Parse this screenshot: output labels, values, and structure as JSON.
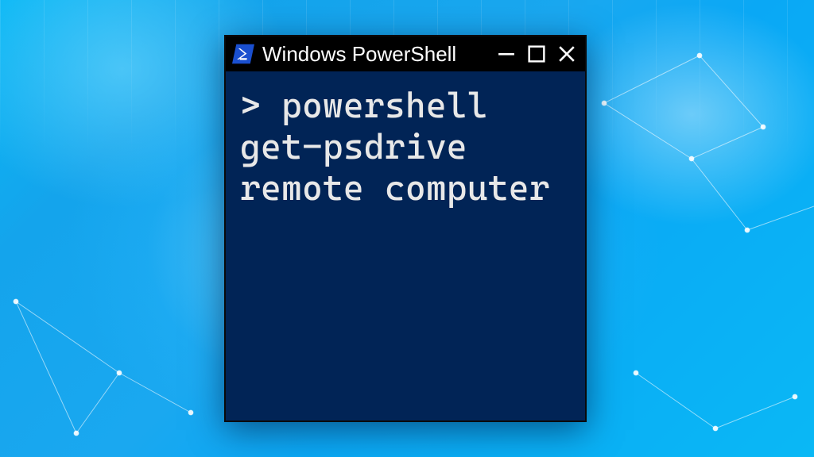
{
  "window": {
    "title": "Windows PowerShell",
    "icon_name": "powershell-icon",
    "colors": {
      "titlebar_bg": "#000000",
      "console_bg": "#012456",
      "console_fg": "#e8e8e8",
      "icon_bg": "#1a4fcf",
      "icon_fg": "#ffffff"
    }
  },
  "terminal": {
    "prompt": ">",
    "command": "powershell get-psdrive remote computer",
    "full_line": "> powershell get-psdrive remote computer"
  },
  "controls": {
    "minimize_label": "Minimize",
    "maximize_label": "Maximize",
    "close_label": "Close"
  }
}
